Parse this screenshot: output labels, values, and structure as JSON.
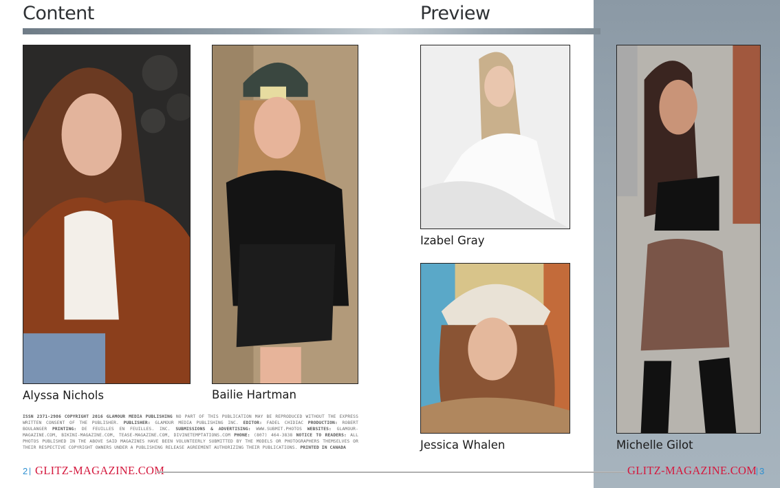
{
  "headings": {
    "content": "Content",
    "preview": "Preview"
  },
  "models": [
    {
      "name": "Alyssa Nichols",
      "photo": "portrait-alyssa-nichols",
      "colors": {
        "bg": "#2c2b2a",
        "hair": "#6b3a22",
        "top": "#8b3f1c",
        "inner": "#f3efe9",
        "skin": "#e3b49c"
      }
    },
    {
      "name": "Bailie Hartman",
      "photo": "portrait-bailie-hartman",
      "colors": {
        "bg": "#b29a7a",
        "hair": "#b98858",
        "top": "#141414",
        "inner": "#1c1c1c",
        "skin": "#e7b49a"
      }
    },
    {
      "name": "Izabel Gray",
      "photo": "portrait-izabel-gray",
      "colors": {
        "bg": "#efefef",
        "hair": "#c9b08c",
        "top": "#fbfbfb",
        "inner": "#ffffff",
        "skin": "#e9c6ae"
      }
    },
    {
      "name": "Jessica Whalen",
      "photo": "portrait-jessica-whalen",
      "colors": {
        "bg": "#d8c48a",
        "hair": "#8a5434",
        "top": "#b0875e",
        "inner": "#e9e2d6",
        "skin": "#e4b89c"
      }
    },
    {
      "name": "Michelle Gilot",
      "photo": "portrait-michelle-gilot",
      "colors": {
        "bg": "#b7b4ae",
        "hair": "#3a2520",
        "top": "#111111",
        "inner": "#7a5548",
        "skin": "#c99478"
      }
    }
  ],
  "legal": {
    "issn": "ISSN 2371-2986 COPYRIGHT 2016 GLAMOUR MEDIA PUBLISHING",
    "t1": " NO PART OF THIS PUBLICATION MAY BE REPRODUCED WITHOUT THE EXPRESS WRITTEN CONSENT OF THE PUBLISHER. ",
    "publisher_label": "PUBLISHER:",
    "t2": " GLAMOUR MEDIA PUBLISHING INC. ",
    "editor_label": "EDITOR:",
    "t3": " FADEL CHIDIAC ",
    "production_label": "PRODUCTION:",
    "t4": " ROBERT BOULANGER ",
    "printing_label": "PRINTING:",
    "t5": " DE FEUILLES EN FEUILLES. INC. ",
    "submissions_label": "SUBMISSIONS & ADVERTISING:",
    "t6": " WWW.SUBMIT.PHOTOS ",
    "websites_label": "WEBSITES:",
    "t7": " GLAMOUR-MAGAZINE.COM, BIKINI-MAGAZINE.COM, TEASE-MAGAZINE.COM, DIVINETEMPTATIONS.COM ",
    "phone_label": "PHONE:",
    "t8": " (807) 464-3838 ",
    "notice_label": "NOTICE TO READERS:",
    "t9": " ALL PHOTOS PUBLISHED IN THE ABOVE SAID MAGAZINES HAVE BEEN VOLUNTEERLY SUBMITTED BY THE MODELS OR PHOTOGRAPHERS THEMSELVES OR THEIR RESPECTIVE COPYRIGHT OWNERS UNDER A PUBLISHING RELEASE AGREEMENT AUTHORIZING THEIR PUBLICATIONS. ",
    "printed": "PRINTED IN CANADA"
  },
  "footer": {
    "left_page": "2",
    "right_page": "3",
    "separator": "|",
    "site": "GLITZ-MAGAZINE.COM",
    "accent": "#d4183d",
    "page_color": "#2c8fd0"
  },
  "icons": [
    "portrait-photo-icon"
  ]
}
